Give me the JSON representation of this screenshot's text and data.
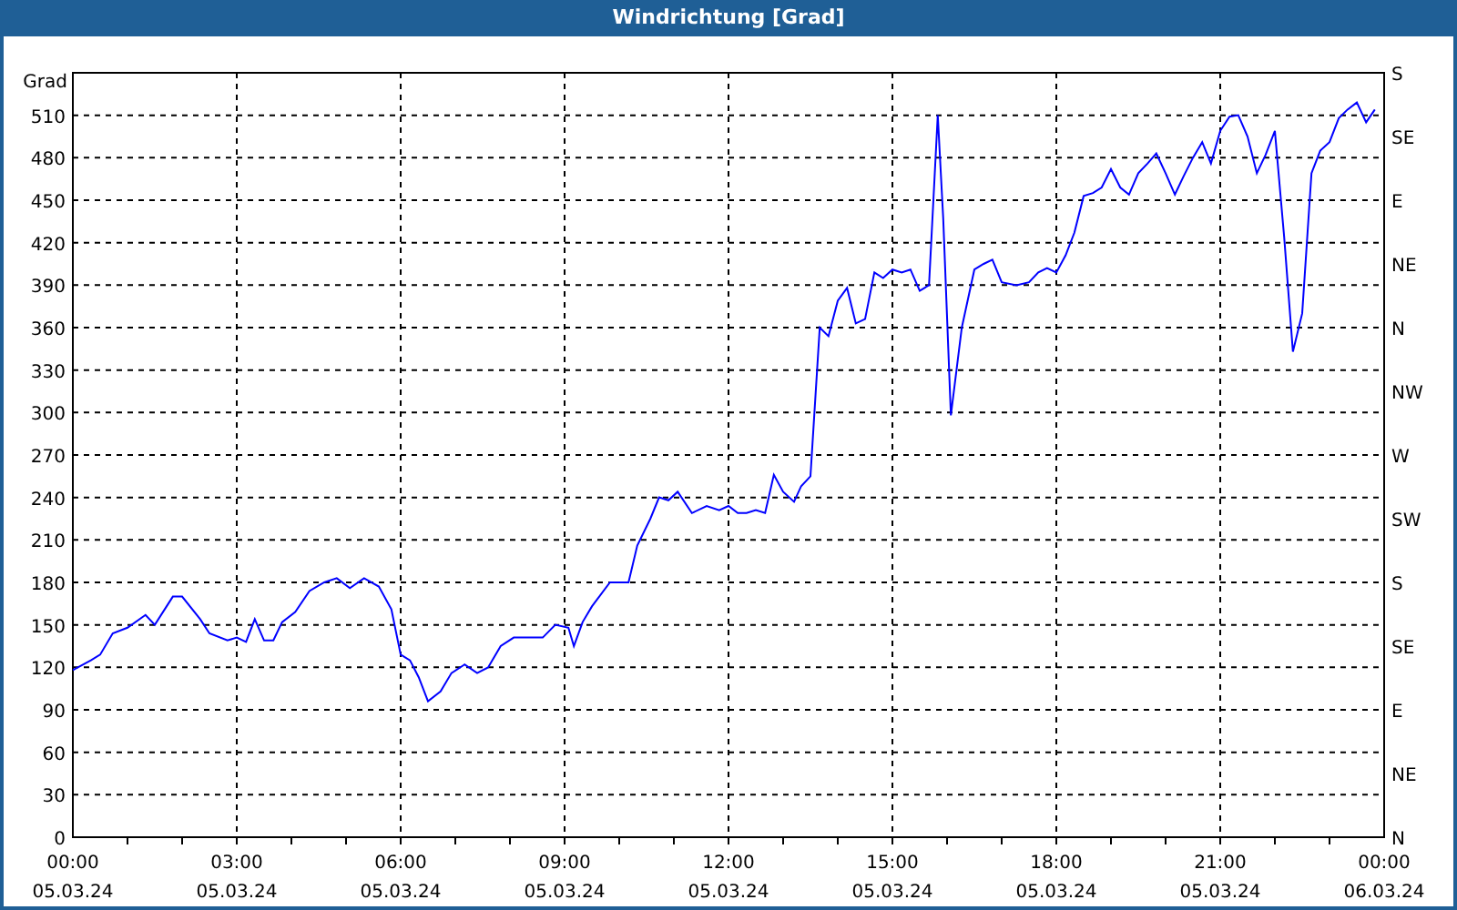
{
  "window": {
    "title": "Windrichtung [Grad]"
  },
  "chart": {
    "compass_labels": [
      "S",
      "SE",
      "E",
      "NE",
      "N",
      "NW",
      "W",
      "SW",
      "S",
      "SE",
      "E",
      "NE",
      "N"
    ],
    "x_dates": [
      "05.03.24",
      "05.03.24",
      "05.03.24",
      "05.03.24",
      "05.03.24",
      "05.03.24",
      "05.03.24",
      "05.03.24",
      "06.03.24"
    ],
    "chart_data": {
      "type": "line",
      "ylabel": "Grad",
      "xlim": [
        0,
        24
      ],
      "ylim": [
        0,
        540
      ],
      "yticks": [
        0,
        30,
        60,
        90,
        120,
        150,
        180,
        210,
        240,
        270,
        300,
        330,
        360,
        390,
        420,
        450,
        480,
        510
      ],
      "grid": true,
      "xticks": [
        {
          "value": 0,
          "label": "00:00"
        },
        {
          "value": 3,
          "label": "03:00"
        },
        {
          "value": 6,
          "label": "06:00"
        },
        {
          "value": 9,
          "label": "09:00"
        },
        {
          "value": 12,
          "label": "12:00"
        },
        {
          "value": 15,
          "label": "15:00"
        },
        {
          "value": 18,
          "label": "18:00"
        },
        {
          "value": 21,
          "label": "21:00"
        },
        {
          "value": 24,
          "label": "00:00"
        }
      ],
      "x": [
        0,
        0.33,
        0.5,
        0.73,
        1,
        1.33,
        1.5,
        1.83,
        2,
        2.33,
        2.5,
        2.83,
        3,
        3.17,
        3.33,
        3.5,
        3.67,
        3.83,
        4.07,
        4.33,
        4.6,
        4.83,
        5.07,
        5.33,
        5.6,
        5.83,
        6,
        6.17,
        6.33,
        6.5,
        6.73,
        6.93,
        7.17,
        7.4,
        7.6,
        7.83,
        8.07,
        8.33,
        8.6,
        8.83,
        9.07,
        9.17,
        9.33,
        9.5,
        9.83,
        10,
        10.17,
        10.33,
        10.57,
        10.73,
        10.9,
        11.07,
        11.33,
        11.6,
        11.83,
        12,
        12.17,
        12.33,
        12.5,
        12.67,
        12.83,
        13,
        13.2,
        13.33,
        13.5,
        13.67,
        13.83,
        14,
        14.17,
        14.33,
        14.5,
        14.67,
        14.83,
        15,
        15.17,
        15.33,
        15.5,
        15.67,
        15.83,
        15.93,
        16.07,
        16.27,
        16.5,
        16.67,
        16.83,
        17,
        17.27,
        17.5,
        17.67,
        17.83,
        18,
        18.17,
        18.33,
        18.5,
        18.67,
        18.83,
        19,
        19.17,
        19.33,
        19.5,
        19.67,
        19.83,
        20,
        20.17,
        20.33,
        20.5,
        20.67,
        20.83,
        21,
        21.17,
        21.33,
        21.5,
        21.67,
        21.83,
        22,
        22.17,
        22.33,
        22.5,
        22.67,
        22.83,
        23,
        23.17,
        23.33,
        23.5,
        23.67,
        23.83
      ],
      "series": [
        {
          "color": "#0000ff",
          "values": [
            118,
            125,
            129,
            144,
            148,
            157,
            150,
            170,
            170,
            154,
            144,
            139,
            141,
            138,
            154,
            139,
            139,
            152,
            159,
            174,
            180,
            183,
            176,
            183,
            177,
            161,
            129,
            125,
            113,
            96,
            103,
            116,
            122,
            116,
            120,
            135,
            141,
            141,
            141,
            150,
            148,
            135,
            152,
            163,
            180,
            180,
            180,
            206,
            225,
            240,
            238,
            244,
            229,
            234,
            231,
            234,
            229,
            229,
            231,
            229,
            256,
            244,
            237,
            248,
            255,
            360,
            354,
            379,
            388,
            363,
            366,
            399,
            395,
            401,
            399,
            401,
            386,
            390,
            510,
            437,
            298,
            360,
            401,
            405,
            408,
            392,
            390,
            392,
            399,
            402,
            399,
            411,
            427,
            453,
            455,
            459,
            472,
            459,
            454,
            469,
            476,
            483,
            469,
            454,
            467,
            480,
            491,
            476,
            499,
            509,
            510,
            495,
            469,
            482,
            499,
            424,
            343,
            370,
            469,
            485,
            491,
            508,
            514,
            519,
            505,
            514
          ]
        }
      ]
    }
  }
}
